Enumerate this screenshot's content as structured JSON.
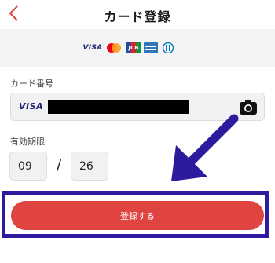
{
  "header": {
    "title": "カード登録",
    "back_icon": "chevron-left-icon"
  },
  "brands": {
    "items": [
      {
        "name": "VISA",
        "icon": "visa-logo"
      },
      {
        "name": "MasterCard",
        "icon": "mastercard-logo"
      },
      {
        "name": "JCB",
        "icon": "jcb-logo"
      },
      {
        "name": "AMERICAN EXPRESS",
        "icon": "amex-logo"
      },
      {
        "name": "Diners Club",
        "icon": "diners-logo"
      }
    ]
  },
  "card_number": {
    "label": "カード番号",
    "brand_text": "VISA",
    "camera_icon": "camera-icon"
  },
  "expiry": {
    "label": "有効期限",
    "month": "09",
    "separator": "/",
    "year": "26"
  },
  "register_button": {
    "label": "登録する"
  },
  "colors": {
    "accent": "#e04441",
    "highlight_border": "#2d1b9e",
    "arrow": "#2d1b9e",
    "back_chevron": "#e04441"
  }
}
